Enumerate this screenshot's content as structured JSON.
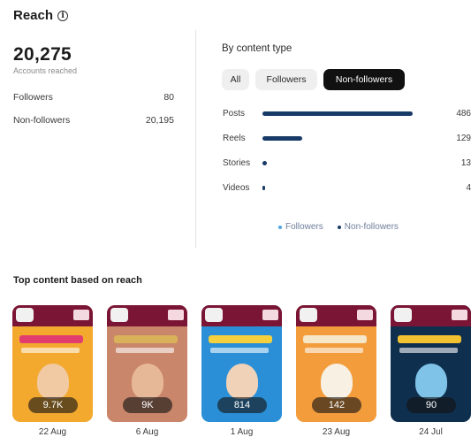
{
  "header": {
    "title": "Reach",
    "info_icon": "info-icon"
  },
  "summary": {
    "total": "20,275",
    "total_label": "Accounts reached",
    "rows": [
      {
        "label": "Followers",
        "value": "80"
      },
      {
        "label": "Non-followers",
        "value": "20,195"
      }
    ]
  },
  "content_type": {
    "title": "By content type",
    "filters": [
      {
        "label": "All",
        "selected": false
      },
      {
        "label": "Followers",
        "selected": false
      },
      {
        "label": "Non-followers",
        "selected": true
      }
    ],
    "bars": [
      {
        "label": "Posts",
        "value": "486",
        "fraction": 1.0
      },
      {
        "label": "Reels",
        "value": "129",
        "fraction": 0.265
      },
      {
        "label": "Stories",
        "value": "13",
        "fraction": 0.027
      },
      {
        "label": "Videos",
        "value": "4",
        "fraction": 0.008
      }
    ],
    "legend": [
      {
        "label": "Followers",
        "color": "#4fa3e0"
      },
      {
        "label": "Non-followers",
        "color": "#183a66"
      }
    ]
  },
  "top_content": {
    "title": "Top content based on reach",
    "items": [
      {
        "reach": "9.7K",
        "date": "22 Aug",
        "bg": "#f2a92e",
        "accent": "#e23d6f",
        "face": "#f1c9a3"
      },
      {
        "reach": "9K",
        "date": "6 Aug",
        "bg": "#c9866a",
        "accent": "#d9b15a",
        "face": "#e7b897"
      },
      {
        "reach": "814",
        "date": "1 Aug",
        "bg": "#2a8fd6",
        "accent": "#f4d03f",
        "face": "#f0d2b8"
      },
      {
        "reach": "142",
        "date": "23 Aug",
        "bg": "#f39c3c",
        "accent": "#f6e7c9",
        "face": "#f7f0e3"
      },
      {
        "reach": "90",
        "date": "24 Jul",
        "bg": "#0f2f4e",
        "accent": "#f2c230",
        "face": "#7fc3e8"
      }
    ]
  }
}
